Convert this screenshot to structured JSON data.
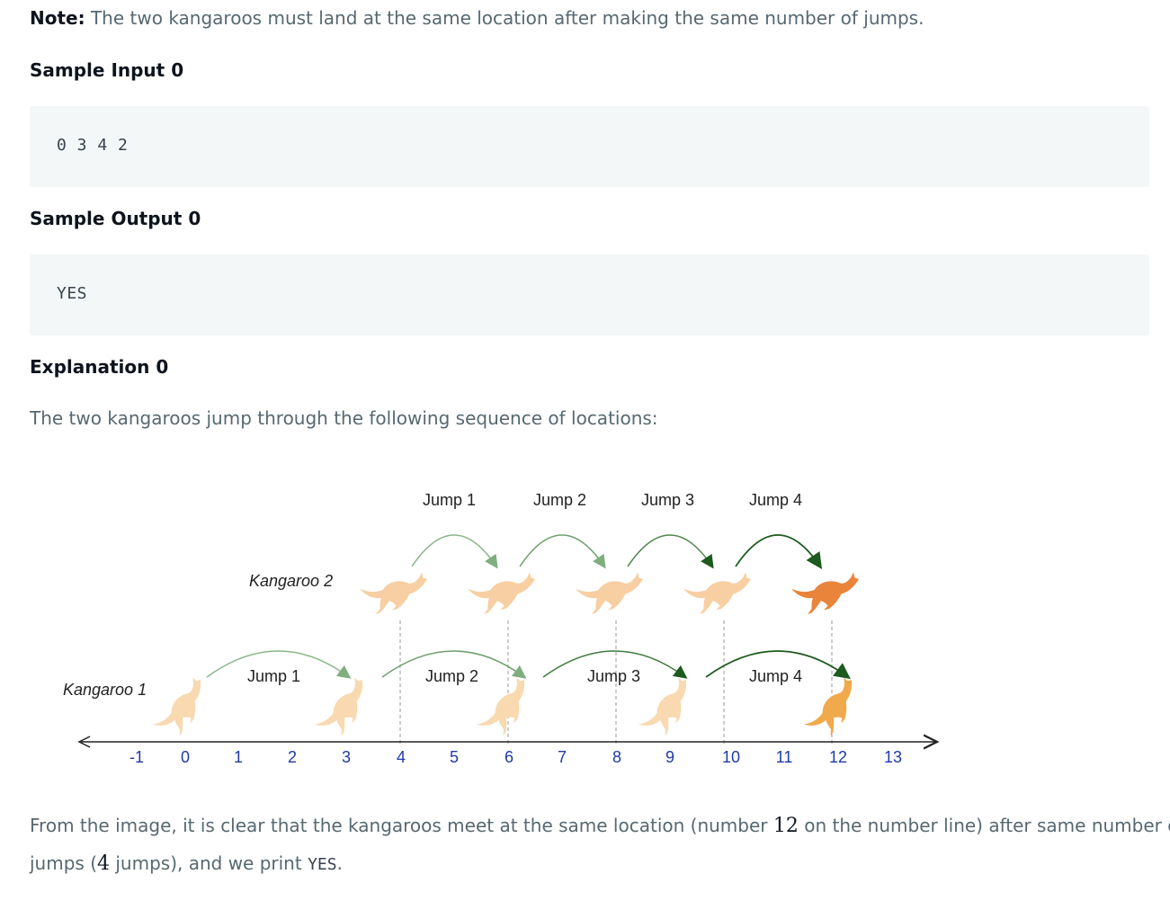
{
  "note": {
    "label": "Note:",
    "text": " The two kangaroos must land at the same location after making the same number of jumps."
  },
  "sample_input": {
    "heading": "Sample Input 0",
    "code": "0 3 4 2"
  },
  "sample_output": {
    "heading": "Sample Output 0",
    "code": "YES"
  },
  "explanation": {
    "heading": "Explanation 0",
    "intro": "The two kangaroos jump through the following sequence of locations:",
    "conclusion_part1": "From the image, it is clear that the kangaroos meet at the same location (number ",
    "meet_number": "12",
    "conclusion_part2": " on the number line) after same number of",
    "conclusion_line2_part1": "jumps (",
    "jump_count": "4",
    "conclusion_line2_part2": " jumps), and we print ",
    "print_value": "YES",
    "conclusion_line2_part3": "."
  },
  "diagram": {
    "kangaroo1_label": "Kangaroo 1",
    "kangaroo2_label": "Kangaroo 2",
    "kangaroo2_jump_labels": [
      "Jump 1",
      "Jump 2",
      "Jump 3",
      "Jump 4"
    ],
    "kangaroo1_jump_labels": [
      "Jump 1",
      "Jump 2",
      "Jump 3",
      "Jump 4"
    ],
    "number_line_ticks": [
      "-1",
      "0",
      "1",
      "2",
      "3",
      "4",
      "5",
      "6",
      "7",
      "8",
      "9",
      "10",
      "11",
      "12",
      "13"
    ],
    "kangaroo1_positions": [
      0,
      3,
      6,
      9,
      12
    ],
    "kangaroo2_positions": [
      4,
      6,
      8,
      10,
      12
    ],
    "colors": {
      "kangaroo_light": "#f7cfa2",
      "kangaroo_light2": "#f8d9b0",
      "kangaroo_final2": "#e9843a",
      "kangaroo_final1": "#f0a94b",
      "arrow_light": "#9cc49c",
      "arrow_dark": "#2e6b2e",
      "tick_blue": "#1f3aa8"
    }
  }
}
